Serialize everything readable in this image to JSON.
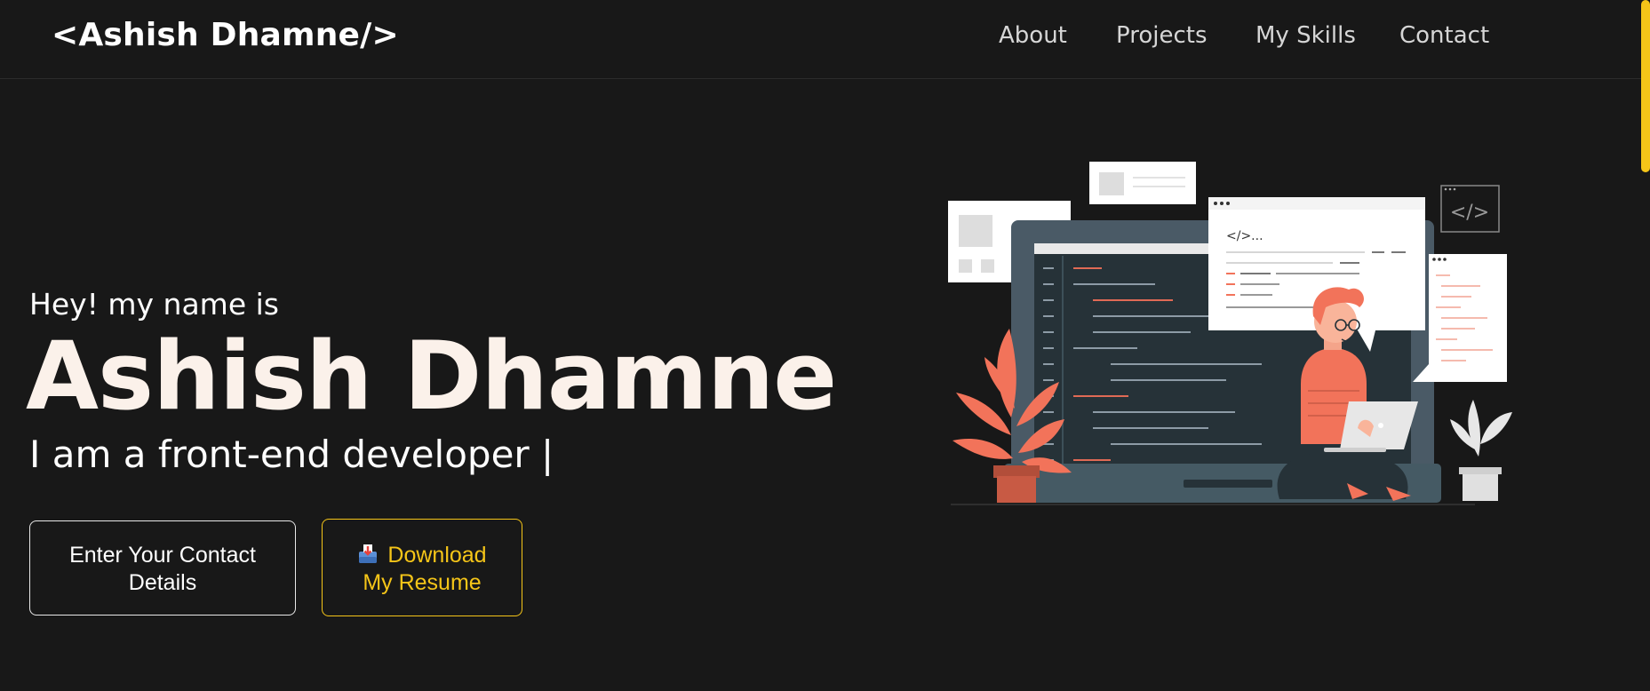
{
  "navbar": {
    "brand": "<Ashish Dhamne/>",
    "links": [
      {
        "label": "About"
      },
      {
        "label": "Projects"
      },
      {
        "label": "My Skills"
      },
      {
        "label": "Contact"
      }
    ]
  },
  "hero": {
    "greeting": "Hey! my name is",
    "name": "Ashish Dhamne",
    "tagline": "I am a front-end developer |",
    "contact_button": "Enter Your Contact Details",
    "resume_button": "Download My Resume",
    "resume_icon": "inbox-tray-icon",
    "illustration_code_label": "</>..."
  },
  "colors": {
    "background": "#181818",
    "accent": "#f5c518",
    "illustration_accent": "#f2735a",
    "name_text": "#fbf1ea"
  }
}
